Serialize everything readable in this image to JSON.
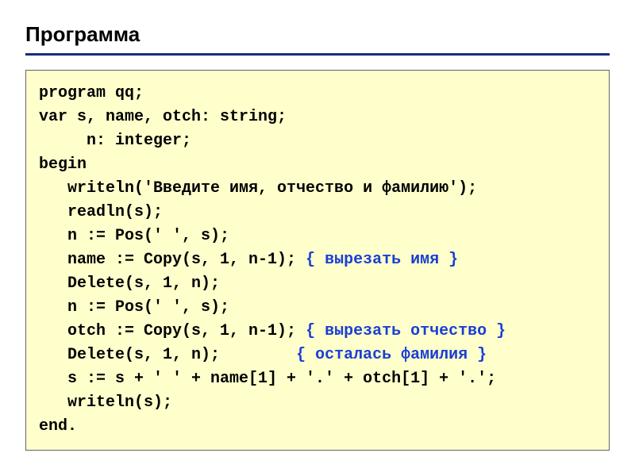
{
  "heading": "Программа",
  "code": {
    "l1": "program qq;",
    "l2": "var s, name, otch: string;",
    "l3": "     n: integer;",
    "l4": "begin",
    "l5": "   writeln('Введите имя, отчество и фамилию');",
    "l6": "   readln(s);",
    "l7": "   n := Pos(' ', s);",
    "l8a": "   name := Copy(s, 1, n-1); ",
    "l8c": "{ вырезать имя }",
    "l9": "   Delete(s, 1, n);",
    "l10": "   n := Pos(' ', s);",
    "l11a": "   otch := Copy(s, 1, n-1); ",
    "l11c": "{ вырезать отчество }",
    "l12a": "   Delete(s, 1, n);        ",
    "l12c": "{ осталась фамилия }",
    "l13": "   s := s + ' ' + name[1] + '.' + otch[1] + '.';",
    "l14": "   writeln(s);",
    "l15": "end."
  }
}
